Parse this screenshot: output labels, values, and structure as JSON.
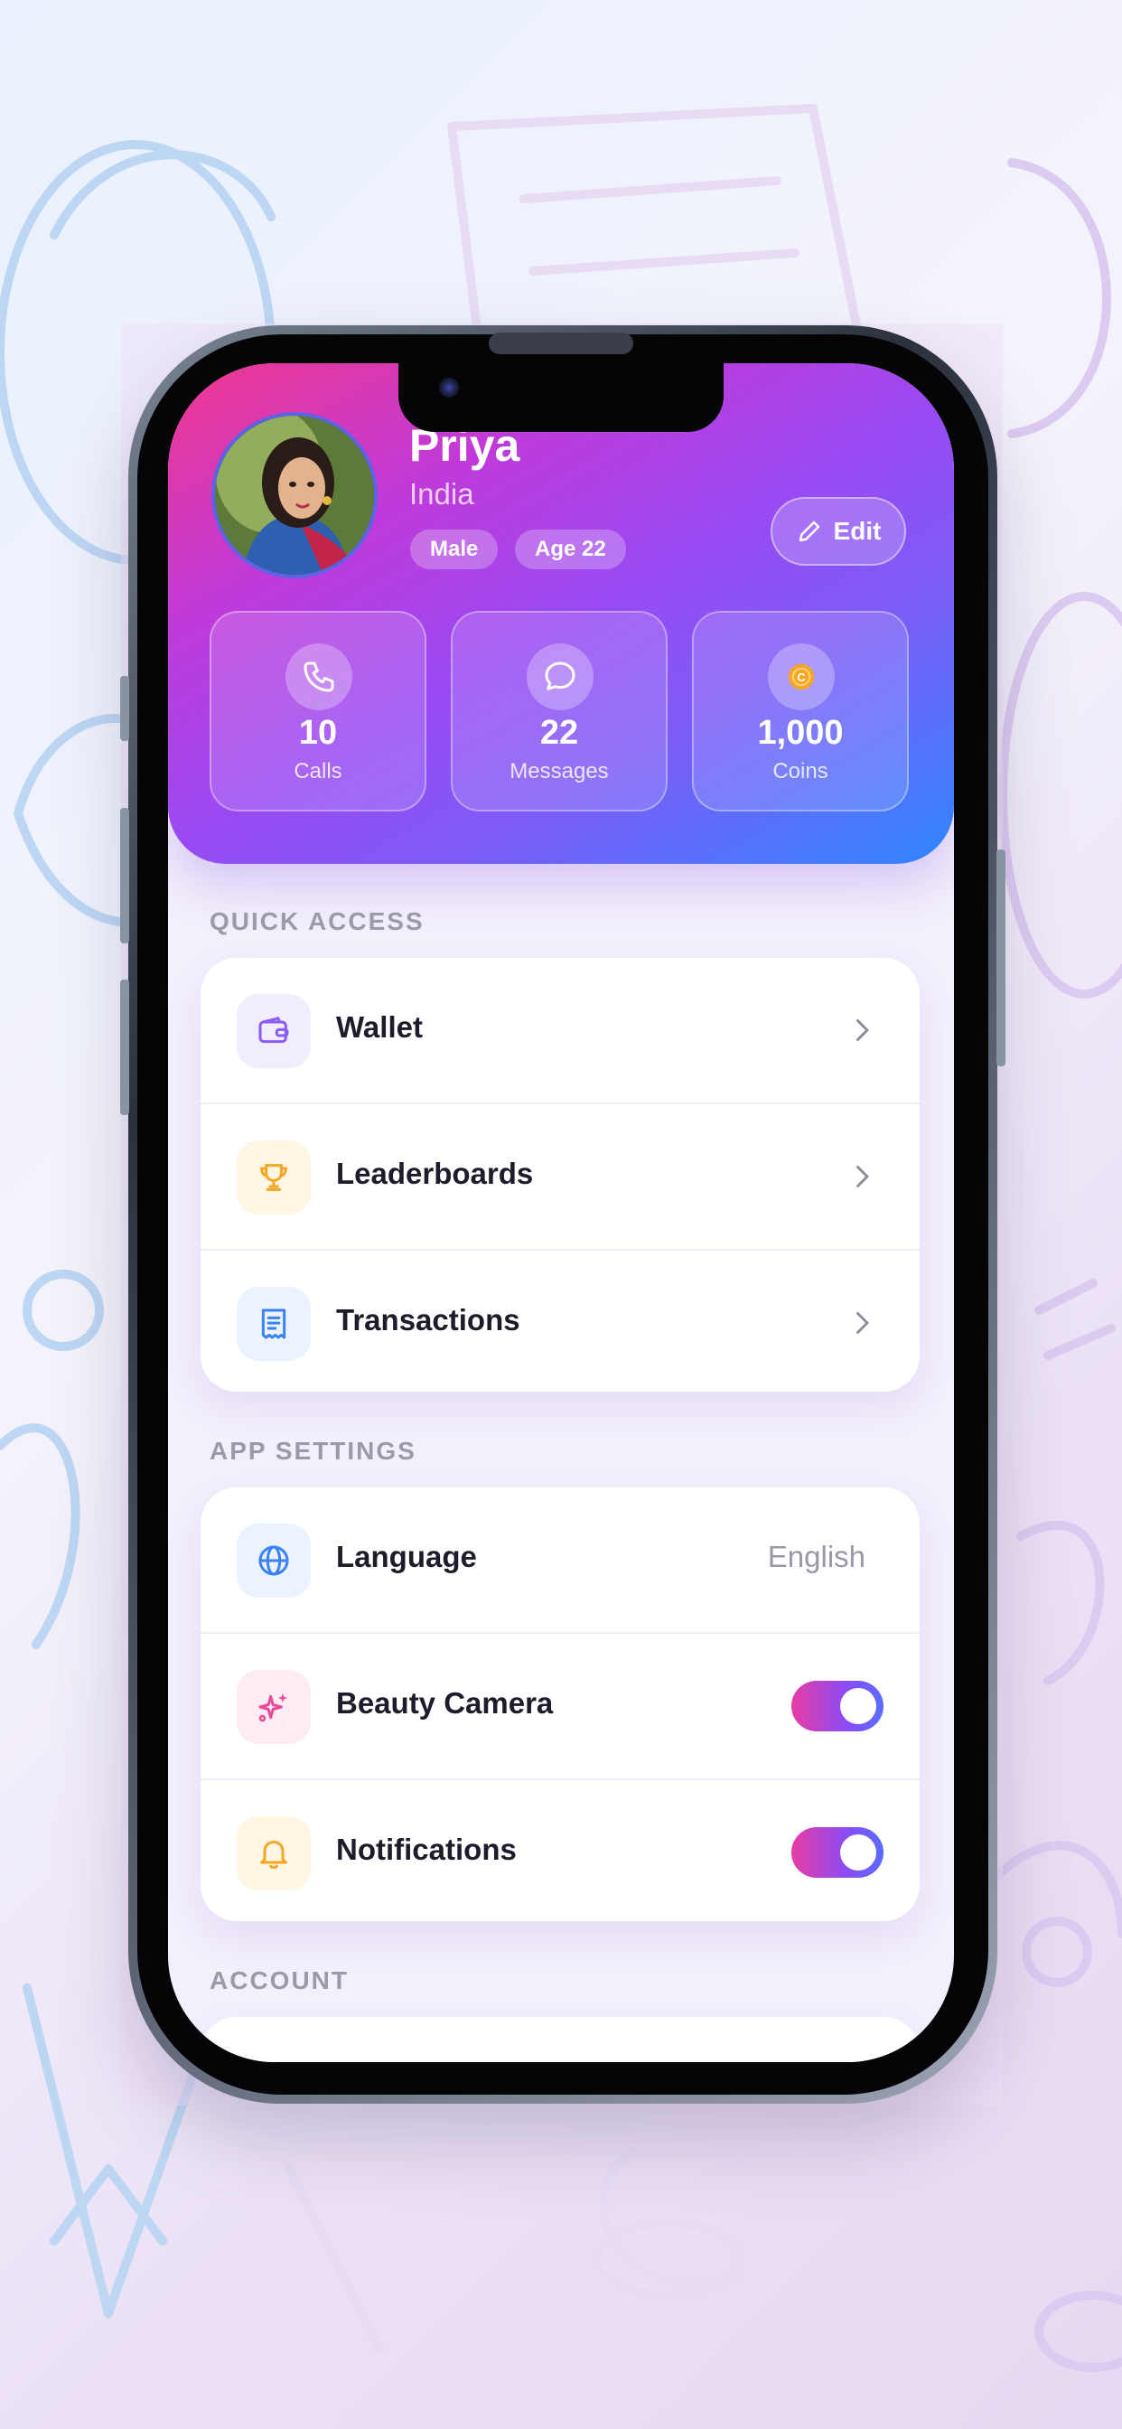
{
  "profile": {
    "name": "Priya",
    "country": "India",
    "gender": "Male",
    "age": "Age 22",
    "edit_label": "Edit"
  },
  "stats": [
    {
      "value": "10",
      "label": "Calls",
      "icon": "phone-icon"
    },
    {
      "value": "22",
      "label": "Messages",
      "icon": "chat-bubble-icon"
    },
    {
      "value": "1,000",
      "label": "Coins",
      "icon": "coin-icon"
    }
  ],
  "quick_access": {
    "title": "QUICK ACCESS",
    "items": [
      {
        "label": "Wallet",
        "icon": "wallet-icon"
      },
      {
        "label": "Leaderboards",
        "icon": "trophy-icon"
      },
      {
        "label": "Transactions",
        "icon": "receipt-icon"
      }
    ]
  },
  "app_settings": {
    "title": "APP SETTINGS",
    "language": {
      "label": "Language",
      "value": "English",
      "icon": "globe-icon"
    },
    "beauty_camera": {
      "label": "Beauty Camera",
      "enabled": true,
      "icon": "sparkles-icon"
    },
    "notifications": {
      "label": "Notifications",
      "enabled": true,
      "icon": "bell-icon"
    }
  },
  "account": {
    "title": "ACCOUNT"
  },
  "colors": {
    "header_gradient": [
      "#f0388e",
      "#9b49f2",
      "#2f86ff"
    ],
    "toggle_gradient": [
      "#e93ca4",
      "#5a6cff"
    ],
    "wallet": "#8b5cf6",
    "trophy": "#f5a623",
    "receipt": "#3b82f6",
    "globe": "#3b82f6",
    "sparkles": "#ec4899",
    "bell": "#f5a623"
  }
}
